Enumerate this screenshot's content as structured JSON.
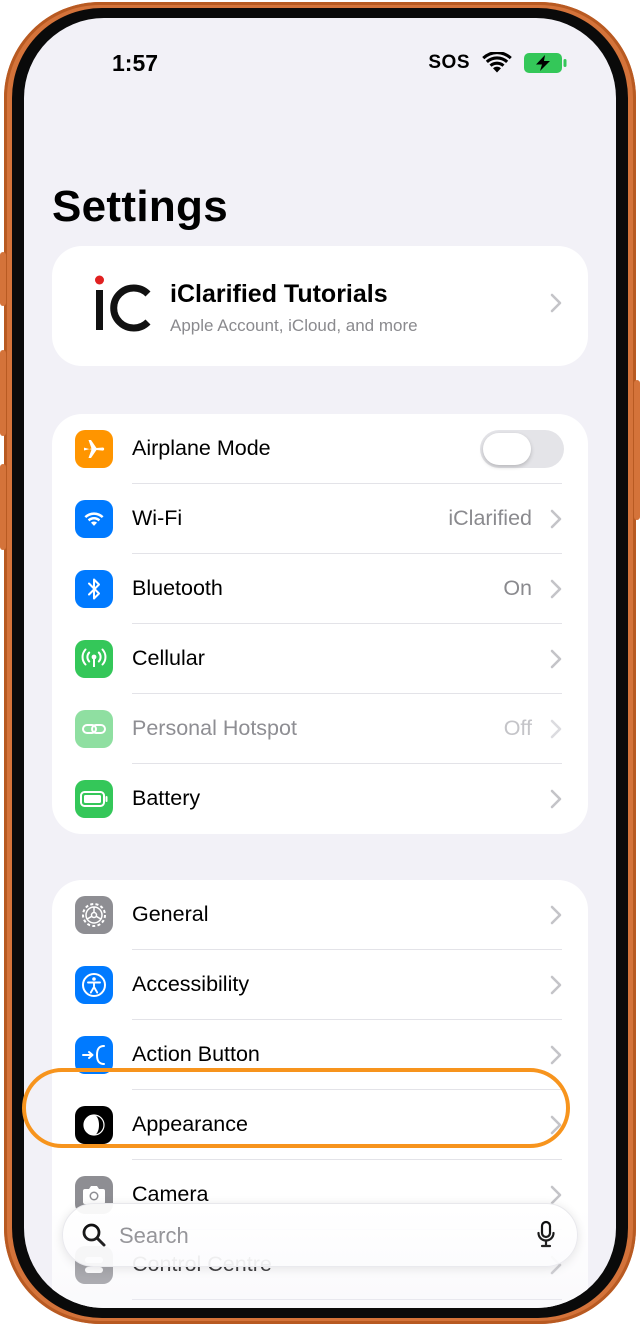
{
  "status_bar": {
    "time": "1:57",
    "carrier": "SOS"
  },
  "page": {
    "title": "Settings"
  },
  "account": {
    "logo_text": "iC",
    "name": "iClarified Tutorials",
    "subtitle": "Apple Account, iCloud, and more"
  },
  "connectivity": [
    {
      "id": "airplane",
      "label": "Airplane Mode",
      "icon": "airplane-icon",
      "color": "#ff9500",
      "toggle": false
    },
    {
      "id": "wifi",
      "label": "Wi-Fi",
      "value": "iClarified",
      "icon": "wifi-icon",
      "color": "#007aff"
    },
    {
      "id": "bluetooth",
      "label": "Bluetooth",
      "value": "On",
      "icon": "bluetooth-icon",
      "color": "#007aff"
    },
    {
      "id": "cellular",
      "label": "Cellular",
      "value": "",
      "icon": "cellular-icon",
      "color": "#34c759"
    },
    {
      "id": "hotspot",
      "label": "Personal Hotspot",
      "value": "Off",
      "icon": "hotspot-icon",
      "color": "#8fdfa1",
      "disabled": true
    },
    {
      "id": "battery",
      "label": "Battery",
      "value": "",
      "icon": "battery-icon",
      "color": "#34c759"
    }
  ],
  "general": [
    {
      "id": "general",
      "label": "General",
      "icon": "gear-icon",
      "color": "#8e8e93"
    },
    {
      "id": "accessibility",
      "label": "Accessibility",
      "icon": "accessibility-icon",
      "color": "#007aff"
    },
    {
      "id": "action",
      "label": "Action Button",
      "icon": "action-button-icon",
      "color": "#007aff"
    },
    {
      "id": "appearance",
      "label": "Appearance",
      "icon": "appearance-icon",
      "color": "#000000",
      "highlighted": true
    },
    {
      "id": "camera",
      "label": "Camera",
      "icon": "camera-icon",
      "color": "#8e8e93"
    },
    {
      "id": "control",
      "label": "Control Centre",
      "icon": "control-centre-icon",
      "color": "#8e8e93"
    }
  ],
  "search": {
    "placeholder": "Search"
  },
  "colors": {
    "highlight": "#f7941d",
    "frame": "#d4733a",
    "battery_charging": "#34c759"
  }
}
